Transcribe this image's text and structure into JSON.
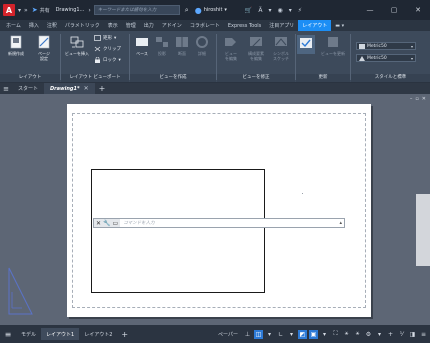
{
  "app": {
    "logo_letter": "A",
    "share_label": "共有",
    "document_title": "Drawing1...",
    "search_placeholder": "キーワードまたは語句を入力",
    "user_name": "hiroshit"
  },
  "ribbon_tabs": [
    {
      "label": "ホーム",
      "active": false
    },
    {
      "label": "挿入",
      "active": false
    },
    {
      "label": "注釈",
      "active": false
    },
    {
      "label": "パラメトリック",
      "active": false
    },
    {
      "label": "表示",
      "active": false
    },
    {
      "label": "管理",
      "active": false
    },
    {
      "label": "出力",
      "active": false
    },
    {
      "label": "アドイン",
      "active": false
    },
    {
      "label": "コラボレート",
      "active": false
    },
    {
      "label": "Express Tools",
      "active": false
    },
    {
      "label": "注目アプリ",
      "active": false
    },
    {
      "label": "レイアウト",
      "active": true
    }
  ],
  "ribbon": {
    "layout_group": {
      "label": "レイアウト",
      "new_layout": "新規作成",
      "page_setup": "ページ\n設定"
    },
    "layout_viewport_group": {
      "label": "レイアウト ビューポート",
      "insert_view": "ビューを挿入",
      "rectangular": "矩形",
      "clip": "クリップ",
      "lock": "ロック"
    },
    "create_view_group": {
      "label": "ビューを作成",
      "base": "ベース",
      "projected": "投影",
      "section": "断面",
      "detail": "詳細"
    },
    "modify_view_group": {
      "label": "ビューを修正",
      "edit_view": "ビュー\nを編集",
      "edit_components": "構成要素\nを編集",
      "symbol_sketch": "シンボル\nスケッチ"
    },
    "update_group": {
      "label": "更新",
      "auto_update": "",
      "update_view": "ビューを更新"
    },
    "styles_group": {
      "label": "スタイルと標準",
      "style1": "Metric50",
      "style2": "Metric50"
    }
  },
  "doc_tabs": {
    "start": "スタート",
    "drawing": "Drawing1*"
  },
  "command_line": {
    "prompt": "コマンドを入力"
  },
  "status_bar": {
    "model_tab": "モデル",
    "layout1_tab": "レイアウト1",
    "layout2_tab": "レイアウト2",
    "paper_label": "ペーパー"
  }
}
